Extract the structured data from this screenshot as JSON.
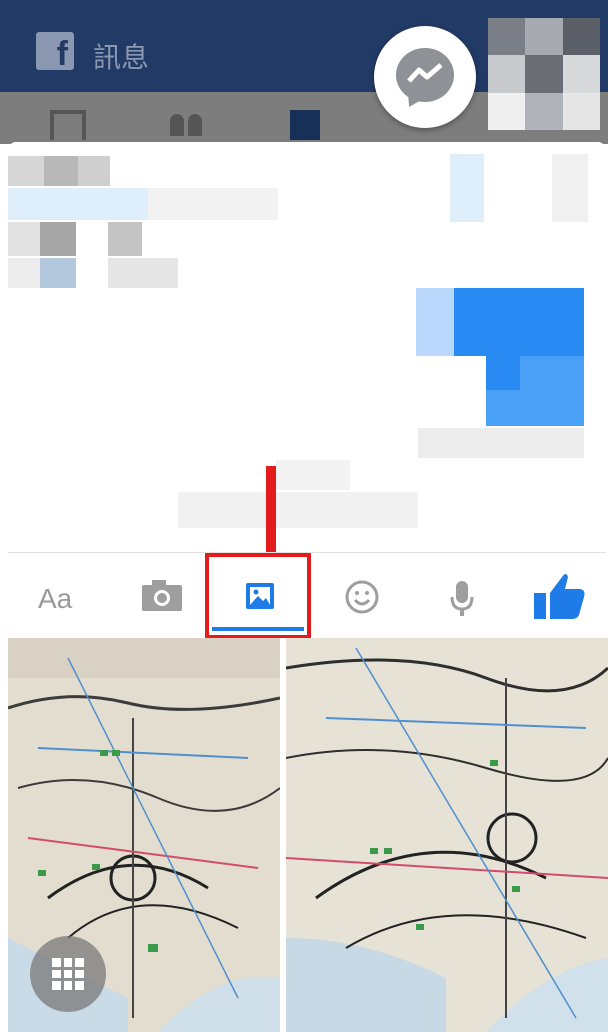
{
  "header": {
    "app_logo": "facebook-f",
    "title": "訊息",
    "bar_color": "#223a66"
  },
  "chat_head": {
    "icon": "messenger-bolt-icon"
  },
  "composer": {
    "text_tool_label": "Aa",
    "camera_icon": "camera-icon",
    "photo_icon": "image-icon",
    "emoji_icon": "smile-icon",
    "mic_icon": "microphone-icon",
    "like_icon": "thumbs-up-icon",
    "active_color": "#1e7be8",
    "highlight_color": "#e31b1b"
  },
  "gallery": {
    "grid_icon": "grid-icon"
  }
}
